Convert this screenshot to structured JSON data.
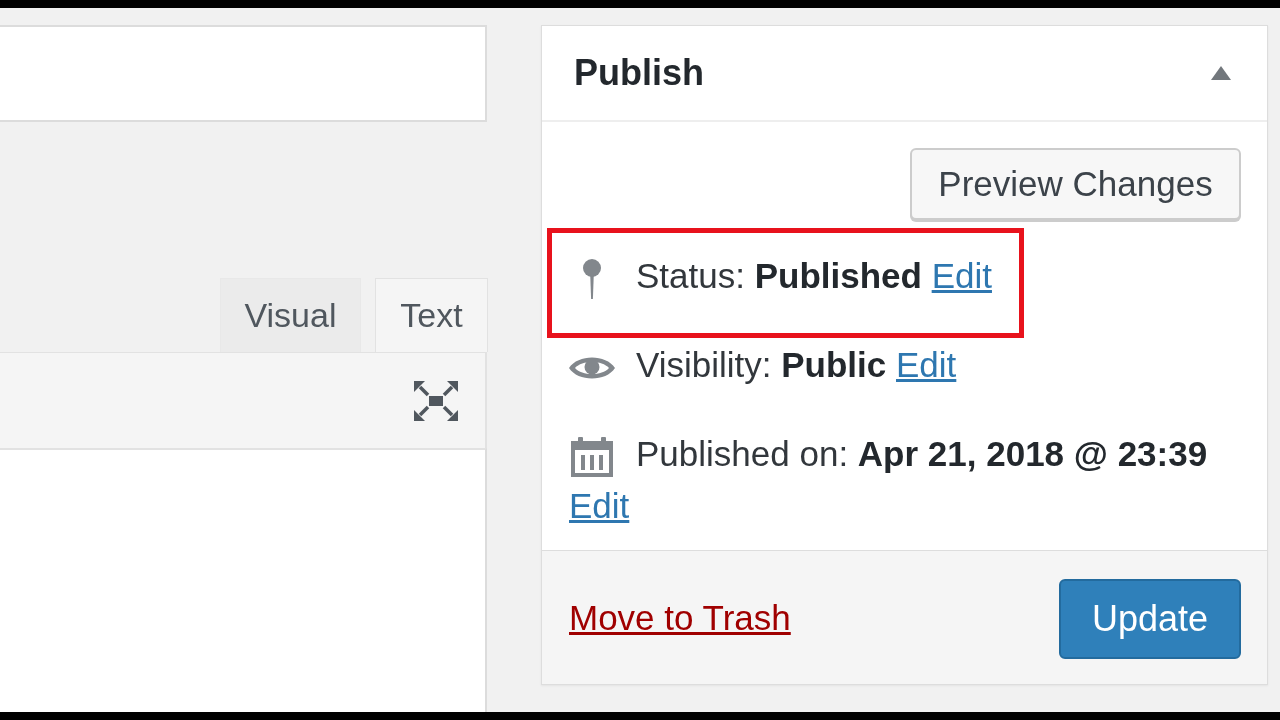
{
  "editor": {
    "tabs": [
      {
        "label": "Visual",
        "selected": false
      },
      {
        "label": "Text",
        "selected": true
      }
    ]
  },
  "publish_box": {
    "title": "Publish",
    "expanded": true,
    "preview_button": "Preview Changes",
    "rows": [
      {
        "kind": "status",
        "text": "Status: **Published**",
        "link": "Edit",
        "highlighted": true
      },
      {
        "kind": "visibility",
        "text": "Visibility: **Public**",
        "link": "Edit",
        "highlighted": false
      },
      {
        "kind": "date",
        "text": "Published on: **Apr 21, 2018 @ 23:39**",
        "link": "Edit",
        "highlighted": false
      }
    ],
    "trash_link": "Move to Trash",
    "update_button": "Update"
  }
}
